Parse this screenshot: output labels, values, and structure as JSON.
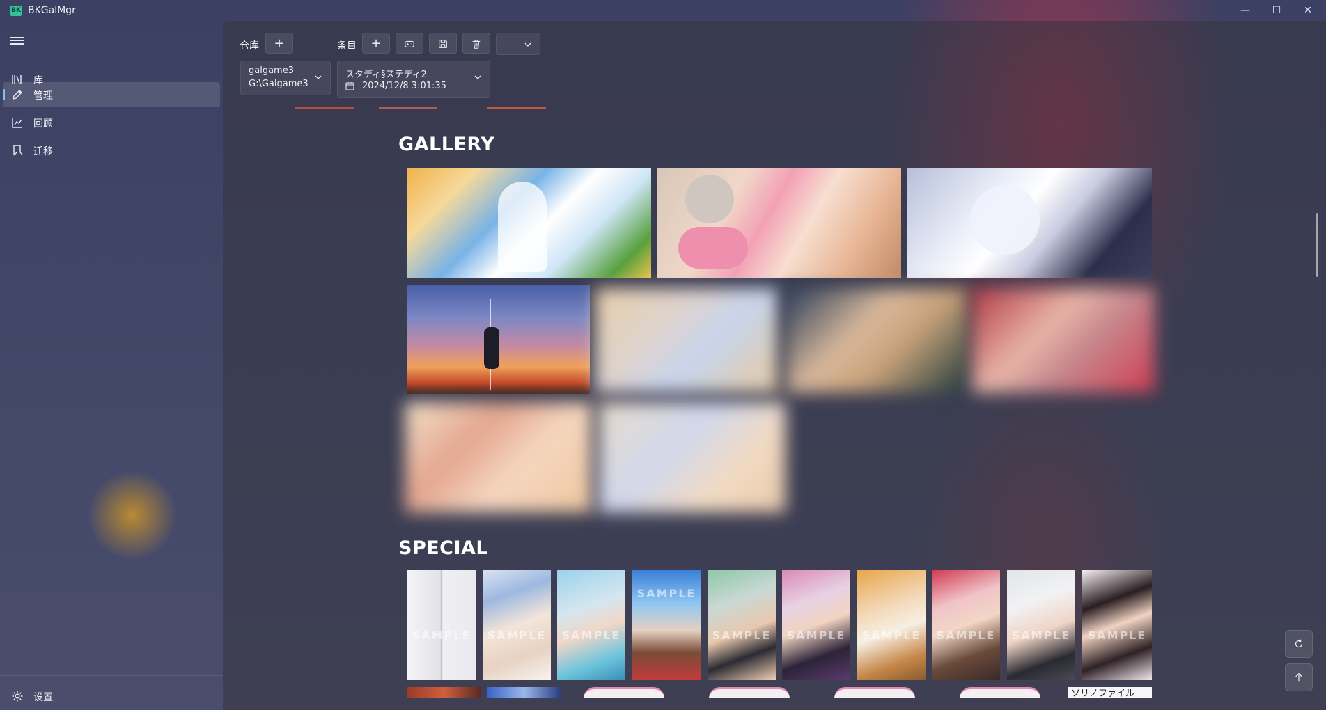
{
  "app": {
    "title": "BKGalMgr"
  },
  "window_controls": {
    "minimize": "—",
    "maximize": "☐",
    "close": "✕"
  },
  "sidebar": {
    "items": [
      {
        "label": "库",
        "icon": "library-icon"
      },
      {
        "label": "管理",
        "icon": "edit-icon",
        "active": true
      },
      {
        "label": "回顾",
        "icon": "chart-icon"
      },
      {
        "label": "迁移",
        "icon": "migrate-icon"
      }
    ],
    "settings": {
      "label": "设置",
      "icon": "gear-icon"
    }
  },
  "toolbar": {
    "repo_label": "仓库",
    "item_label": "条目",
    "add_repo": "+",
    "add_item": "+",
    "repo_dropdown": {
      "name": "galgame3",
      "path": "G:\\Galgame3"
    },
    "item_dropdown": {
      "name": "スタディ§ステディ2",
      "date": "2024/12/8 3:01:35"
    }
  },
  "sections": {
    "gallery": {
      "title": "GALLERY"
    },
    "special": {
      "title": "SPECIAL",
      "sample_text": "SAMPLE"
    },
    "partial_text": "ソリノファイル"
  },
  "colors": {
    "accent": "#7cc4f2",
    "logo": "#33c29a"
  }
}
